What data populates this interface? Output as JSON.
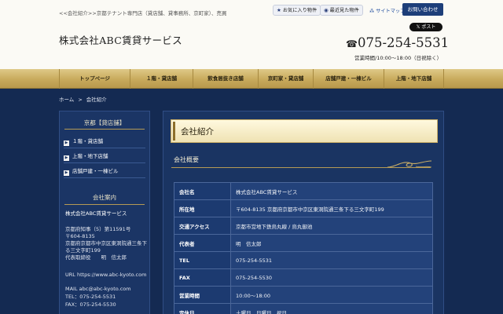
{
  "header": {
    "tagline": "<<会社紹介>>京都テナント専門店（貸店舗、貸事務所、京町家）、売買",
    "logo": "株式会社ABC賃貸サービス",
    "favorites_label": "お気に入り物件",
    "recent_label": "最近見た物件",
    "sitemap_label": "サイトマップ",
    "contact_label": "お問い合わせ",
    "xpost_label": "ポスト",
    "phone": "075-254-5531",
    "hours": "営業時間/10:00～18:00（日祝除く）"
  },
  "nav": {
    "items": [
      "トップページ",
      "１階・貸店舗",
      "飲食居抜き店舗",
      "京町家・貸店舗",
      "店舗戸建・一棟ビル",
      "上階・地下店舗"
    ]
  },
  "breadcrumb": {
    "home": "ホーム",
    "separator": ">",
    "current": "会社紹介"
  },
  "sidebar": {
    "section_title": "京都【貸店舗】",
    "links": [
      "１階・貸店舗",
      "上階・地下店舗",
      "店舗戸建・一棟ビル"
    ],
    "company_title": "会社案内",
    "company_name": "株式会社ABC賃貸サービス",
    "license": "京都府知事（5）第11591号",
    "postal": "〒604-8135",
    "address": "京都府京都市中京区東洞院通三条下る三文字町199",
    "representative": "代表取締役　　明　信太郎",
    "url": "URL https://www.abc-kyoto.com",
    "mail": "MAIL abc@abc-kyoto.com",
    "tel": "TEL：075-254-5531",
    "fax": "FAX：075-254-5530"
  },
  "main": {
    "page_title": "会社紹介",
    "section_title": "会社概要",
    "rows": [
      {
        "label": "会社名",
        "value": "株式会社ABC賃貸サービス"
      },
      {
        "label": "所在地",
        "value": "〒604-8135 京都府京都市中京区東洞院通三条下る三文字町199"
      },
      {
        "label": "交通アクセス",
        "value": "京都市営地下鉄烏丸線 / 烏丸御池"
      },
      {
        "label": "代表者",
        "value": "明　信太郎"
      },
      {
        "label": "TEL",
        "value": "075-254-5531"
      },
      {
        "label": "FAX",
        "value": "075-254-5530"
      },
      {
        "label": "営業時間",
        "value": "10:00～18:00"
      },
      {
        "label": "定休日",
        "value": "土曜日、日曜日、祝日"
      }
    ]
  }
}
